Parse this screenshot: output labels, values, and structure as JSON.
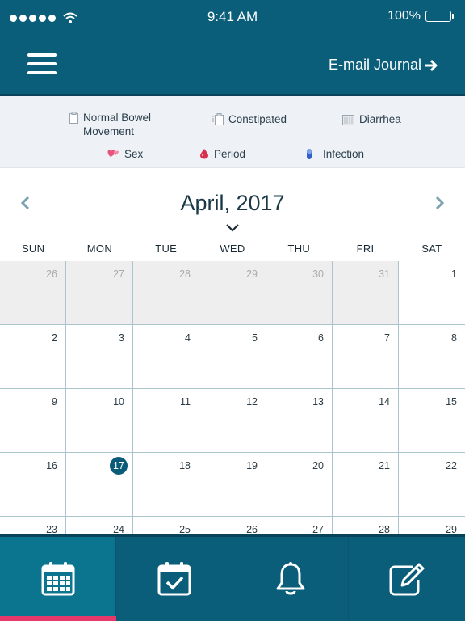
{
  "status_bar": {
    "time": "9:41 AM",
    "battery": "100%",
    "battery_level": 1.0
  },
  "header": {
    "email_label": "E-mail Journal"
  },
  "legend": [
    {
      "label": "Normal Bowel Movement",
      "icon": "normal-bowel-icon"
    },
    {
      "label": "Constipated",
      "icon": "constipated-icon"
    },
    {
      "label": "Diarrhea",
      "icon": "diarrhea-icon"
    },
    {
      "label": "Sex",
      "icon": "sex-icon"
    },
    {
      "label": "Period",
      "icon": "period-icon"
    },
    {
      "label": "Infection",
      "icon": "infection-icon"
    }
  ],
  "legend_lines": {
    "normal_bowel_1": "Normal Bowel",
    "normal_bowel_2": "Movement"
  },
  "calendar": {
    "title": "April, 2017",
    "weekdays": [
      "SUN",
      "MON",
      "TUE",
      "WED",
      "THU",
      "FRI",
      "SAT"
    ],
    "today": 17,
    "weeks": [
      [
        26,
        27,
        28,
        29,
        30,
        31,
        1
      ],
      [
        2,
        3,
        4,
        5,
        6,
        7,
        8
      ],
      [
        9,
        10,
        11,
        12,
        13,
        14,
        15
      ],
      [
        16,
        17,
        18,
        19,
        20,
        21,
        22
      ],
      [
        23,
        24,
        25,
        26,
        27,
        28,
        29
      ]
    ],
    "leading_muted_count": 6
  },
  "tabs": [
    {
      "name": "calendar",
      "icon": "calendar-icon",
      "active": true
    },
    {
      "name": "checklist",
      "icon": "calendar-check-icon",
      "active": false
    },
    {
      "name": "reminders",
      "icon": "bell-icon",
      "active": false
    },
    {
      "name": "notes",
      "icon": "edit-icon",
      "active": false
    }
  ],
  "colors": {
    "primary": "#0a5e7a",
    "active_tab": "#0b7590",
    "accent": "#e8386a",
    "today": "#0a5b78"
  }
}
